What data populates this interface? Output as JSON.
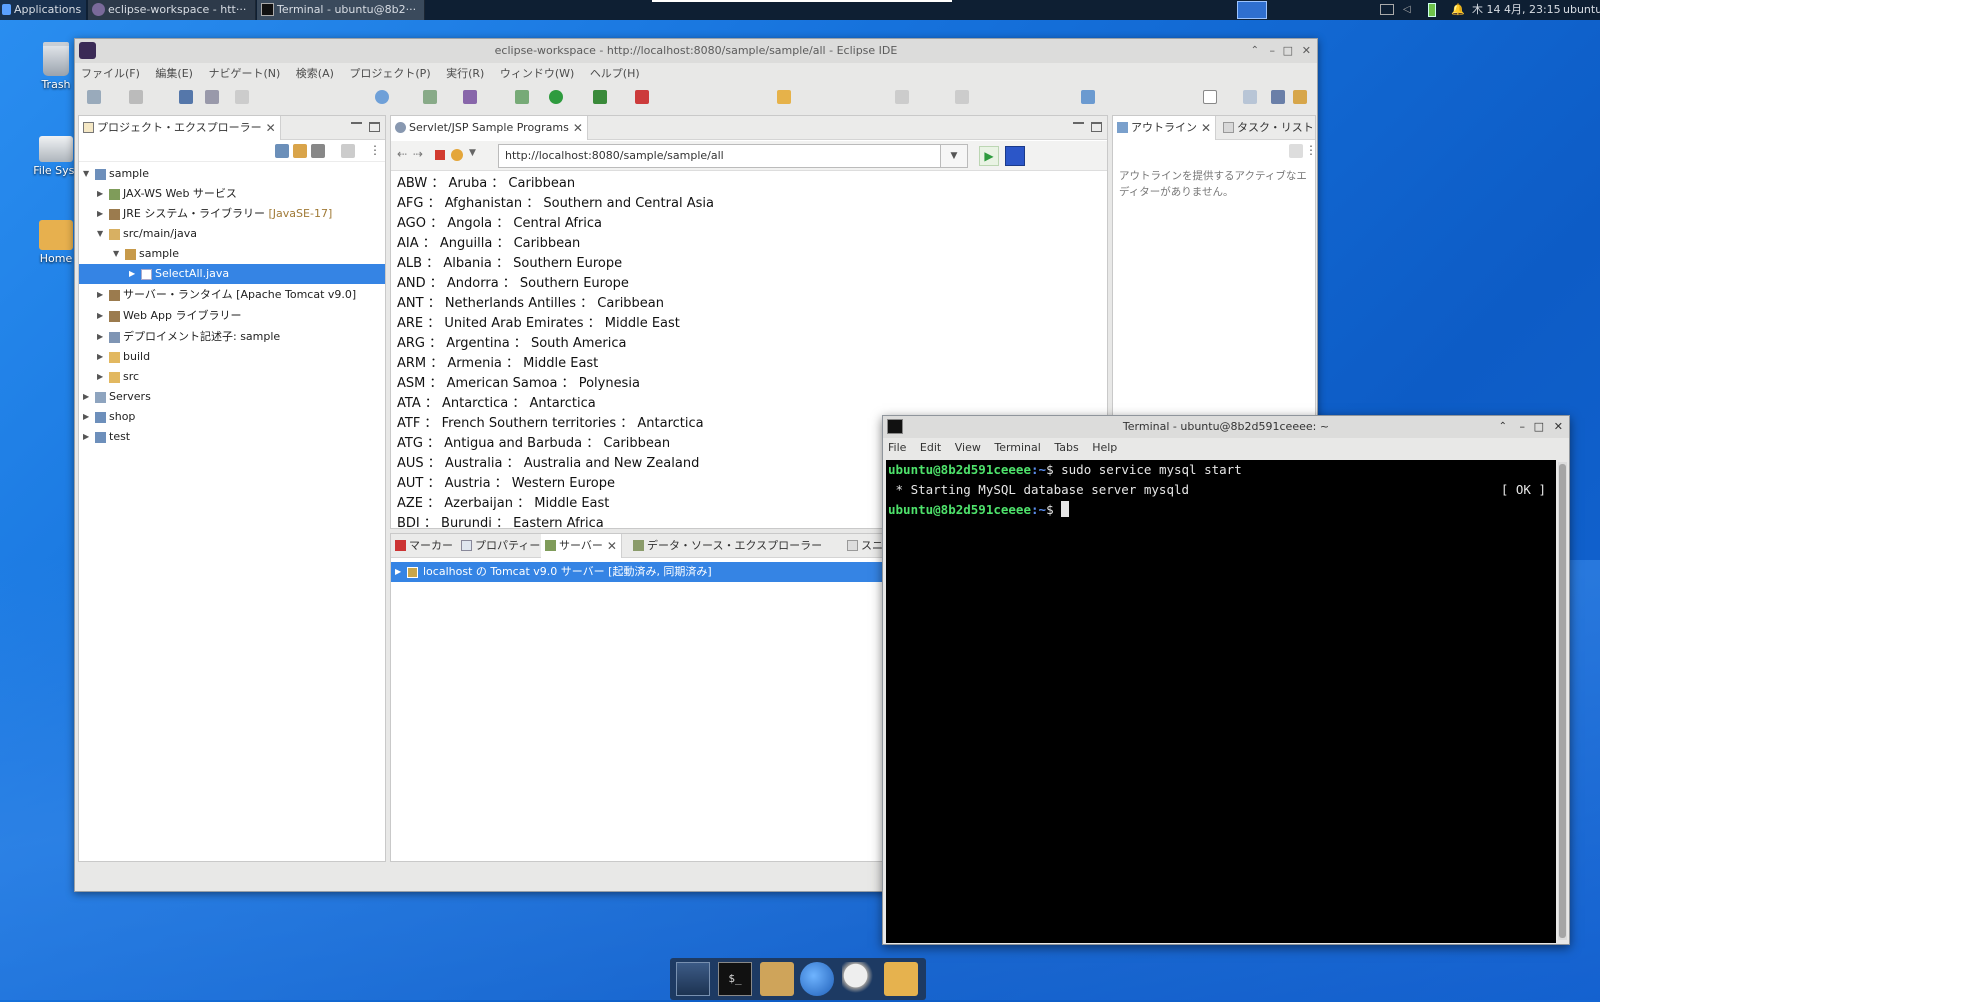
{
  "top_panel": {
    "applications_label": "Applications",
    "tasks": [
      "eclipse-workspace - htt···",
      "Terminal - ubuntu@8b2···"
    ],
    "clock": "木 14 4月, 23:15",
    "user": "ubuntu"
  },
  "desktop": {
    "icons": [
      {
        "label": "Trash",
        "icon": "trash-icon"
      },
      {
        "label": "File Syst",
        "icon": "drive-icon"
      },
      {
        "label": "Home",
        "icon": "home-folder-icon"
      }
    ]
  },
  "eclipse": {
    "title": "eclipse-workspace - http://localhost:8080/sample/sample/all - Eclipse IDE",
    "menu": [
      "ファイル(F)",
      "編集(E)",
      "ナビゲート(N)",
      "検索(A)",
      "プロジェクト(P)",
      "実行(R)",
      "ウィンドウ(W)",
      "ヘルプ(H)"
    ],
    "explorer": {
      "tab": "プロジェクト・エクスプローラー",
      "tree": [
        {
          "label": "sample",
          "suffix": ""
        },
        {
          "label": "JAX-WS Web サービス",
          "suffix": ""
        },
        {
          "label": "JRE システム・ライブラリー",
          "suffix": "[JavaSE-17]"
        },
        {
          "label": "src/main/java",
          "suffix": ""
        },
        {
          "label": "sample",
          "suffix": ""
        },
        {
          "label": "SelectAll.java",
          "suffix": ""
        },
        {
          "label": "サーバー・ランタイム [Apache Tomcat v9.0]",
          "suffix": ""
        },
        {
          "label": "Web App ライブラリー",
          "suffix": ""
        },
        {
          "label": "デプロイメント記述子: sample",
          "suffix": ""
        },
        {
          "label": "build",
          "suffix": ""
        },
        {
          "label": "src",
          "suffix": ""
        },
        {
          "label": "Servers",
          "suffix": ""
        },
        {
          "label": "shop",
          "suffix": ""
        },
        {
          "label": "test",
          "suffix": ""
        }
      ]
    },
    "browser": {
      "tab": "Servlet/JSP Sample Programs",
      "url": "http://localhost:8080/sample/sample/all",
      "rows": [
        "ABW ： Aruba ： Caribbean",
        "AFG ： Afghanistan ： Southern and Central Asia",
        "AGO ： Angola ： Central Africa",
        "AIA ： Anguilla ： Caribbean",
        "ALB ： Albania ： Southern Europe",
        "AND ： Andorra ： Southern Europe",
        "ANT ： Netherlands Antilles ： Caribbean",
        "ARE ： United Arab Emirates ： Middle East",
        "ARG ： Argentina ： South America",
        "ARM ： Armenia ： Middle East",
        "ASM ： American Samoa ： Polynesia",
        "ATA ： Antarctica ： Antarctica",
        "ATF ： French Southern territories ： Antarctica",
        "ATG ： Antigua and Barbuda ： Caribbean",
        "AUS ： Australia ： Australia and New Zealand",
        "AUT ： Austria ： Western Europe",
        "AZE ： Azerbaijan ： Middle East",
        "BDI ： Burundi ： Eastern Africa"
      ]
    },
    "outline": {
      "tabs": [
        "アウトライン",
        "タスク・リスト"
      ],
      "message": "アウトラインを提供するアクティブなエディターがありません。"
    },
    "bottom": {
      "tabs": [
        "マーカー",
        "プロパティー",
        "サーバー",
        "データ・ソース・エクスプローラー",
        "スニペ"
      ],
      "server_row": "localhost の Tomcat v9.0 サーバー  [起動済み, 同期済み]"
    }
  },
  "terminal": {
    "title": "Terminal - ubuntu@8b2d591ceeee: ~",
    "menu": [
      "File",
      "Edit",
      "View",
      "Terminal",
      "Tabs",
      "Help"
    ],
    "prompt_user": "ubuntu@8b2d591ceeee",
    "prompt_path": ":~",
    "prompt_sym": "$",
    "command": " sudo service mysql start",
    "output": " * Starting MySQL database server mysqld",
    "status": "[ OK ]"
  },
  "colors": {
    "selection": "#3584e4",
    "prompt_green": "#4ee26b",
    "desktop_blue": "#1672dc"
  }
}
